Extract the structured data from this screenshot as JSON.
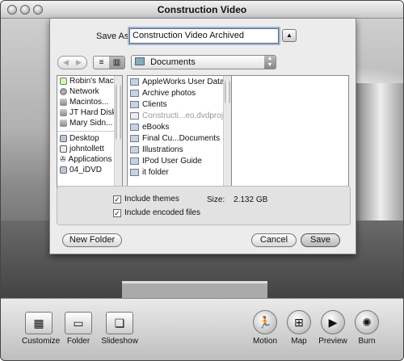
{
  "window": {
    "title": "Construction Video"
  },
  "save_dialog": {
    "save_as_label": "Save As:",
    "save_as_value": "Construction Video Archived",
    "expand_glyph": "▲",
    "location": "Documents",
    "sidebar": {
      "devices": [
        {
          "label": "Robin's Mac",
          "icon": "computer-icon"
        },
        {
          "label": "Network",
          "icon": "network-icon"
        },
        {
          "label": "Macintos...",
          "icon": "disk-icon"
        },
        {
          "label": "JT Hard Disk",
          "icon": "disk-icon"
        },
        {
          "label": "Mary Sidn...",
          "icon": "disk-icon"
        }
      ],
      "places": [
        {
          "label": "Desktop",
          "icon": "desktop-icon"
        },
        {
          "label": "johntollett",
          "icon": "home-icon"
        },
        {
          "label": "Applications",
          "icon": "applications-icon"
        },
        {
          "label": "04_iDVD",
          "icon": "folder-icon"
        }
      ]
    },
    "files": [
      {
        "label": "AppleWorks User Data",
        "has_arrow": true,
        "disabled": false
      },
      {
        "label": "Archive photos",
        "has_arrow": true,
        "disabled": false
      },
      {
        "label": "Clients",
        "has_arrow": true,
        "disabled": false
      },
      {
        "label": "Constructi...eo.dvdproj",
        "has_arrow": false,
        "disabled": true
      },
      {
        "label": "eBooks",
        "has_arrow": true,
        "disabled": false
      },
      {
        "label": "Final Cu...Documents",
        "has_arrow": true,
        "disabled": false
      },
      {
        "label": "Illustrations",
        "has_arrow": true,
        "disabled": false
      },
      {
        "label": "IPod User Guide",
        "has_arrow": true,
        "disabled": false
      },
      {
        "label": "it folder",
        "has_arrow": true,
        "disabled": false
      }
    ],
    "options": {
      "include_themes": {
        "label": "Include themes",
        "checked": true
      },
      "include_encoded": {
        "label": "Include encoded files",
        "checked": true
      },
      "size_label": "Size:",
      "size_value": "2.132 GB"
    },
    "buttons": {
      "new_folder": "New Folder",
      "cancel": "Cancel",
      "save": "Save"
    }
  },
  "toolbar": {
    "left_tools": [
      {
        "label": "Customize",
        "icon": "customize-icon"
      },
      {
        "label": "Folder",
        "icon": "folder-icon"
      },
      {
        "label": "Slideshow",
        "icon": "slideshow-icon"
      }
    ],
    "right_tools": [
      {
        "label": "Motion",
        "icon": "motion-icon"
      },
      {
        "label": "Map",
        "icon": "map-icon"
      },
      {
        "label": "Preview",
        "icon": "preview-icon"
      },
      {
        "label": "Burn",
        "icon": "burn-icon"
      }
    ]
  }
}
